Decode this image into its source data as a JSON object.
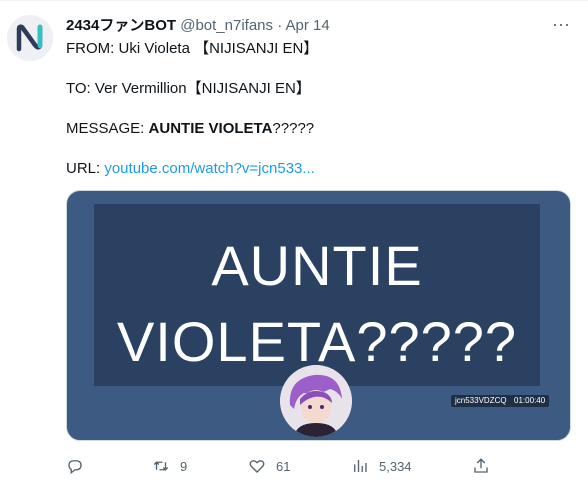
{
  "tweet": {
    "display_name": "2434ファンBOT",
    "handle": "@bot_n7ifans",
    "separator": "·",
    "date": "Apr 14",
    "more_icon": "more-horizontal-icon",
    "lines": {
      "from_label": "FROM: ",
      "from_value": "Uki Violeta 【NIJISANJI EN】",
      "to_label": "TO: ",
      "to_value": "Ver Vermillion【NIJISANJI EN】",
      "message_label": "MESSAGE: ",
      "message_bold": "AUNTIE VIOLETA",
      "message_rest": "?????",
      "url_label": "URL: ",
      "url_value": "youtube.com/watch?v=jcn533..."
    }
  },
  "card": {
    "line1": "AUNTIE",
    "line2": "VIOLETA?????",
    "video_id": "jcn533VDZCQ",
    "duration": "01:00:40",
    "bg_color": "#3c5a82"
  },
  "actions": {
    "reply": {
      "icon": "reply-icon",
      "count": ""
    },
    "retweet": {
      "icon": "retweet-icon",
      "count": "9"
    },
    "like": {
      "icon": "heart-icon",
      "count": "61"
    },
    "views": {
      "icon": "views-chart-icon",
      "count": "5,334"
    },
    "share": {
      "icon": "share-icon",
      "count": ""
    }
  },
  "colors": {
    "link": "#1d9bf0",
    "muted": "#536471",
    "text": "#0f1419"
  }
}
